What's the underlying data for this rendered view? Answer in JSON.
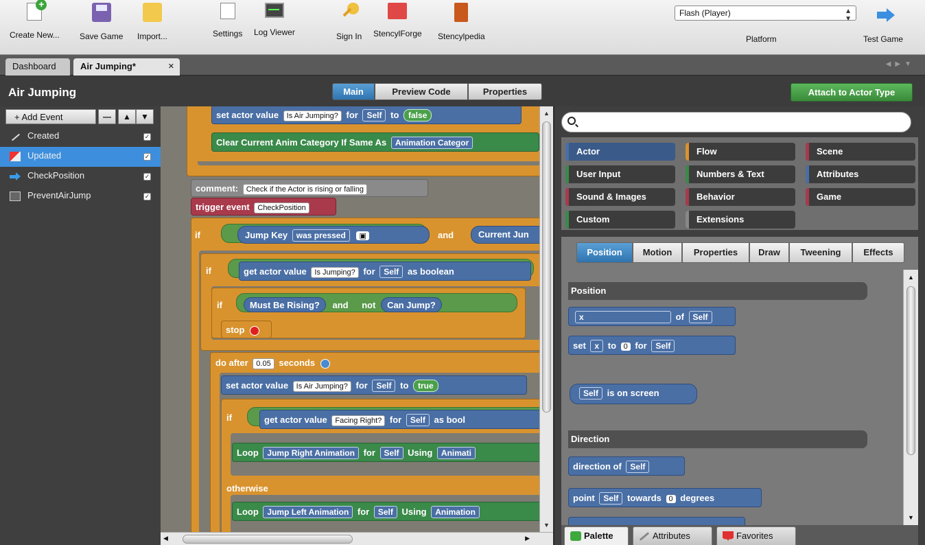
{
  "toolbar": {
    "create_new": "Create New...",
    "save_game": "Save Game",
    "import": "Import...",
    "settings": "Settings",
    "log_viewer": "Log Viewer",
    "sign_in": "Sign In",
    "stencylforge": "StencylForge",
    "stencylpedia": "Stencylpedia",
    "platform_value": "Flash (Player)",
    "platform_label": "Platform",
    "test_game": "Test Game"
  },
  "tabs": {
    "dashboard": "Dashboard",
    "current": "Air Jumping*"
  },
  "header": {
    "title": "Air Jumping",
    "mode_main": "Main",
    "mode_preview": "Preview Code",
    "mode_properties": "Properties",
    "attach": "Attach to Actor Type"
  },
  "events": {
    "add_label": "+ Add Event",
    "items": [
      {
        "label": "Created",
        "icon": "wand-icon",
        "checked": true
      },
      {
        "label": "Updated",
        "icon": "flag-icon",
        "checked": true,
        "selected": true
      },
      {
        "label": "CheckPosition",
        "icon": "arrow-icon",
        "checked": true
      },
      {
        "label": "PreventAirJump",
        "icon": "screen-icon",
        "checked": true
      }
    ]
  },
  "canvas": {
    "set_actor_value": "set actor value",
    "is_air_jumping": "Is Air Jumping?",
    "for": "for",
    "self": "Self",
    "to": "to",
    "false": "false",
    "true": "true",
    "clear_anim": "Clear Current Anim Category If Same As",
    "animation_category": "Animation Categor",
    "comment": "comment:",
    "comment_text": "Check if the Actor is rising or falling",
    "trigger_event": "trigger event",
    "check_position": "CheckPosition",
    "if": "if",
    "jump_key": "Jump Key",
    "was_pressed": "was pressed",
    "and": "and",
    "current_jump": "Current Jun",
    "get_actor_value": "get actor value",
    "is_jumping": "Is Jumping?",
    "as_boolean": "as boolean",
    "must_be_rising": "Must Be Rising?",
    "not": "not",
    "can_jump": "Can Jump?",
    "stop": "stop",
    "do_after": "do after",
    "delay": "0.05",
    "seconds": "seconds",
    "facing_right": "Facing Right?",
    "as_bool": "as bool",
    "loop": "Loop",
    "jump_right": "Jump Right Animation",
    "jump_left": "Jump Left Animation",
    "using": "Using",
    "animation_trunc": "Animati",
    "animation_trunc2": "Animation",
    "otherwise": "otherwise"
  },
  "palette": {
    "categories": [
      {
        "label": "Actor",
        "color": "#4a6fa5",
        "selected": true
      },
      {
        "label": "Flow",
        "color": "#d9932e"
      },
      {
        "label": "Scene",
        "color": "#a83a4c"
      },
      {
        "label": "User Input",
        "color": "#3a8a4a"
      },
      {
        "label": "Numbers & Text",
        "color": "#3a8a4a"
      },
      {
        "label": "Attributes",
        "color": "#4a6fa5"
      },
      {
        "label": "Sound & Images",
        "color": "#a83a4c"
      },
      {
        "label": "Behavior",
        "color": "#a83a4c"
      },
      {
        "label": "Game",
        "color": "#a83a4c"
      },
      {
        "label": "Custom",
        "color": "#3a8a4a"
      },
      {
        "label": "Extensions",
        "color": "#888888"
      }
    ],
    "subtabs": [
      "Position",
      "Motion",
      "Properties",
      "Draw",
      "Tweening",
      "Effects"
    ],
    "section_position": "Position",
    "x": "x",
    "of": "of",
    "self": "Self",
    "set": "set",
    "to": "to",
    "zero": "0",
    "for": "for",
    "is_on_screen": "is on screen",
    "section_direction": "Direction",
    "direction_of": "direction of",
    "point": "point",
    "towards": "towards",
    "degrees": "degrees",
    "bottom_tabs": [
      "Palette",
      "Attributes",
      "Favorites"
    ]
  }
}
